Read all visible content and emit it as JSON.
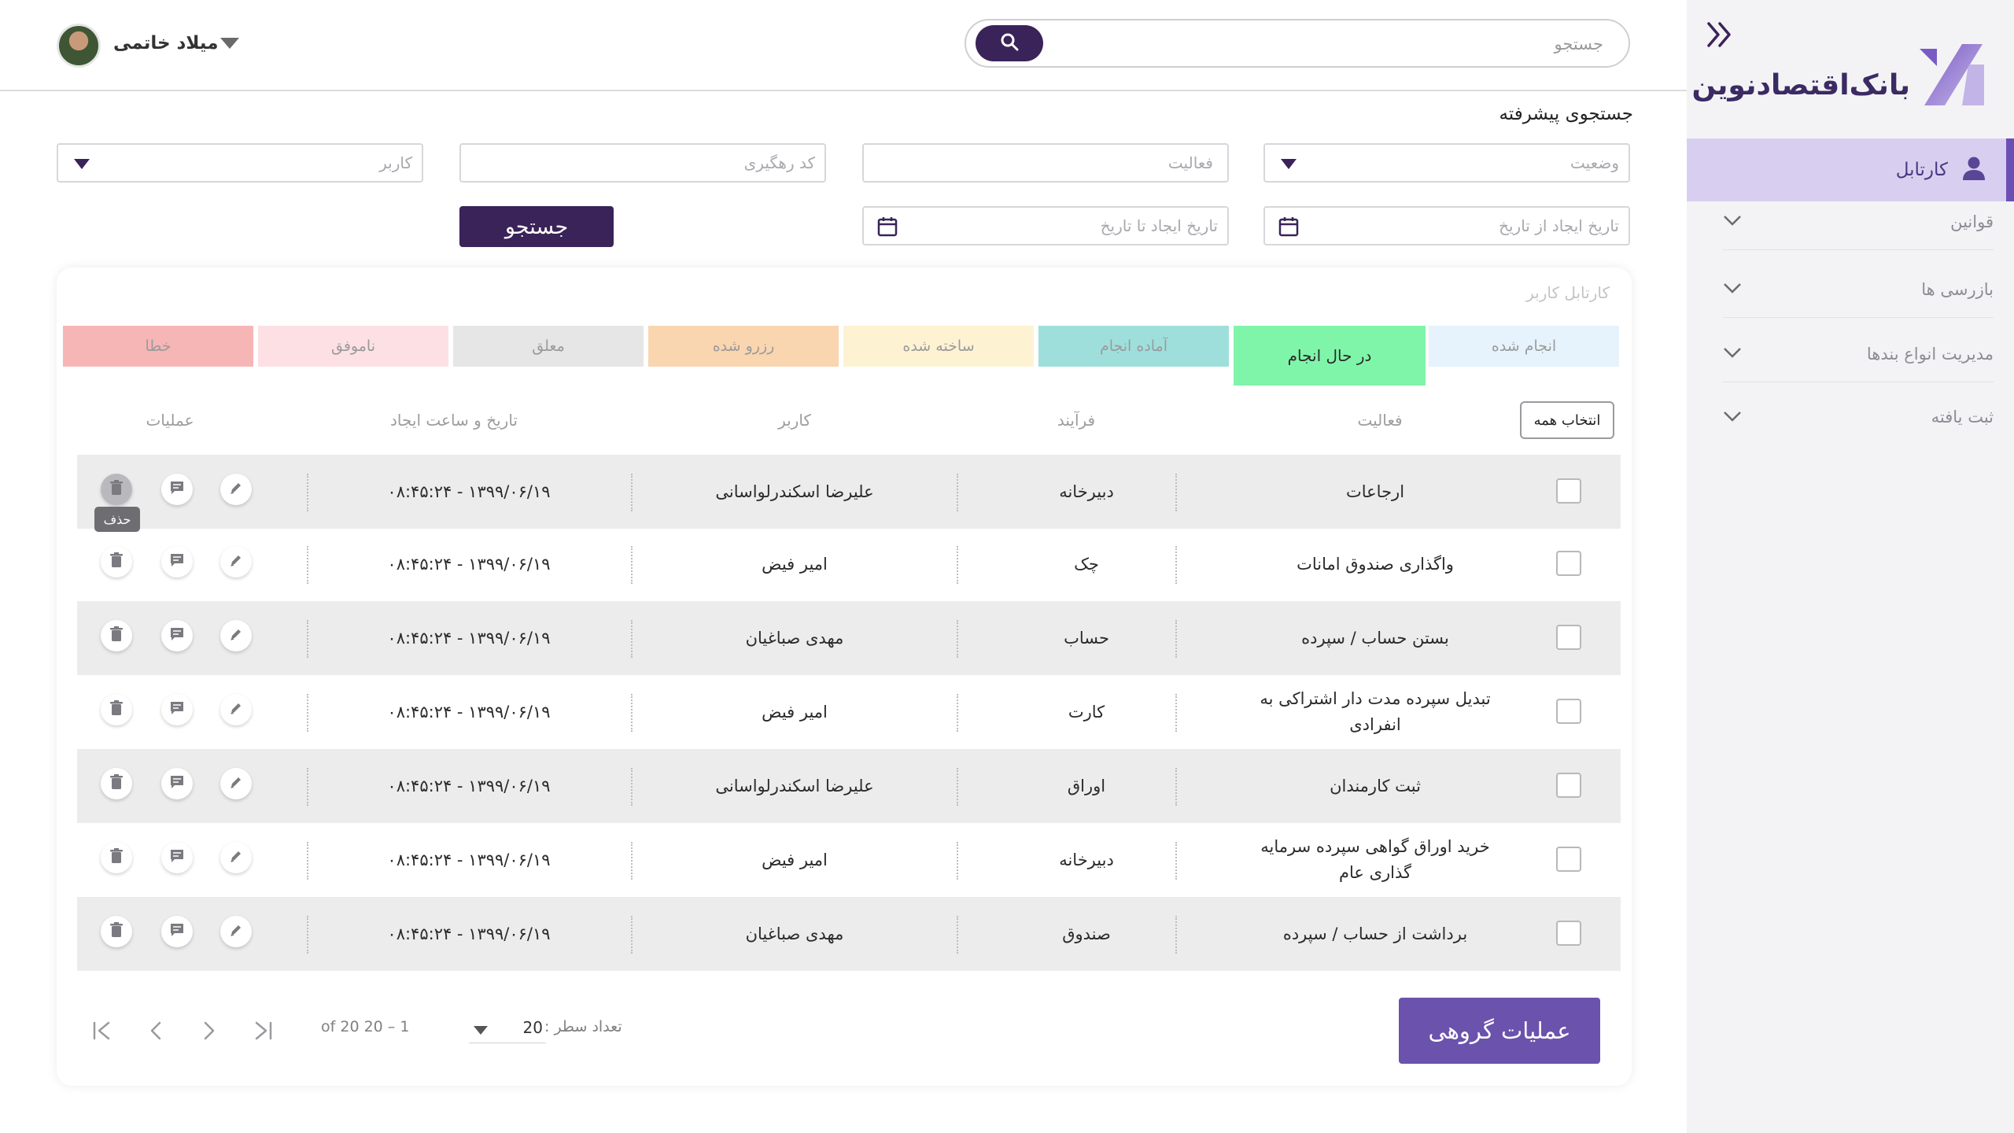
{
  "sidebar": {
    "logo_text": "بانک‌اقتصادنوین",
    "active_item": {
      "label": "کارتابل",
      "icon": "user-icon"
    },
    "items": [
      {
        "label": "قوانین"
      },
      {
        "label": "بازرسی ها"
      },
      {
        "label": "مدیریت انواع بندها"
      },
      {
        "label": "ثبت یافته"
      }
    ]
  },
  "header": {
    "user_name": "میلاد خاتمی",
    "search_placeholder": "جستجو"
  },
  "advanced_search": {
    "title": "جستجوی پیشرفته",
    "status_placeholder": "وضعیت",
    "activity_placeholder": "فعالیت",
    "tracking_placeholder": "کد رهگیری",
    "user_placeholder": "کاربر",
    "date_from_placeholder": "تاریخ ایجاد از تاریخ",
    "date_to_placeholder": "تاریخ ایجاد تا تاریخ",
    "submit_label": "جستجو"
  },
  "cartable": {
    "title": "کارتابل کاربر",
    "tabs": [
      {
        "label": "انجام شده",
        "color": "#e6f3fc"
      },
      {
        "label": "در حال انجام",
        "color": "#7ff5a9"
      },
      {
        "label": "آماده انجام",
        "color": "#9edfdc"
      },
      {
        "label": "ساخته شده",
        "color": "#fdf3d2"
      },
      {
        "label": "رزرو شده",
        "color": "#f9d5b0"
      },
      {
        "label": "معلق",
        "color": "#e6e6e6"
      },
      {
        "label": "ناموفق",
        "color": "#fde0e4"
      },
      {
        "label": "خطا",
        "color": "#f6b6b6"
      }
    ],
    "select_all_label": "انتخاب همه",
    "columns": {
      "activity": "فعالیت",
      "process": "فرآیند",
      "user": "کاربر",
      "created": "تاریخ و ساعت ایجاد",
      "operations": "عملیات"
    },
    "rows": [
      {
        "activity": "ارجاعات",
        "process": "دبیرخانه",
        "user": "علیرضا اسکندرلواسانی",
        "created": "۰۸:۴۵:۲۴  -  ۱۳۹۹/۰۶/۱۹"
      },
      {
        "activity": "واگذاری صندوق امانات",
        "process": "چک",
        "user": "امیر فیض",
        "created": "۰۸:۴۵:۲۴  -  ۱۳۹۹/۰۶/۱۹"
      },
      {
        "activity": "بستن حساب / سپرده",
        "process": "حساب",
        "user": "مهدی صباغیان",
        "created": "۰۸:۴۵:۲۴  -  ۱۳۹۹/۰۶/۱۹"
      },
      {
        "activity": "تبدیل سپرده مدت دار اشتراکی به انفرادی",
        "process": "کارت",
        "user": "امیر فیض",
        "created": "۰۸:۴۵:۲۴  -  ۱۳۹۹/۰۶/۱۹"
      },
      {
        "activity": "ثبت کارمندان",
        "process": "اوراق",
        "user": "علیرضا اسکندرلواسانی",
        "created": "۰۸:۴۵:۲۴  -  ۱۳۹۹/۰۶/۱۹"
      },
      {
        "activity": "خرید اوراق گواهی سپرده سرمایه گذاری عام",
        "process": "دبیرخانه",
        "user": "امیر فیض",
        "created": "۰۸:۴۵:۲۴  -  ۱۳۹۹/۰۶/۱۹"
      },
      {
        "activity": "برداشت از حساب / سپرده",
        "process": "صندوق",
        "user": "مهدی صباغیان",
        "created": "۰۸:۴۵:۲۴  -  ۱۳۹۹/۰۶/۱۹"
      }
    ],
    "delete_tooltip": "حذف",
    "pagination": {
      "rows_label": "تعداد سطر :",
      "page_size": "20",
      "range": "of 20 20 – 1"
    },
    "group_ops_label": "عملیات گروهی"
  },
  "colors": {
    "primary_dark": "#3a2358",
    "primary": "#6b52ad",
    "sidebar_active": "#d8cff0"
  }
}
